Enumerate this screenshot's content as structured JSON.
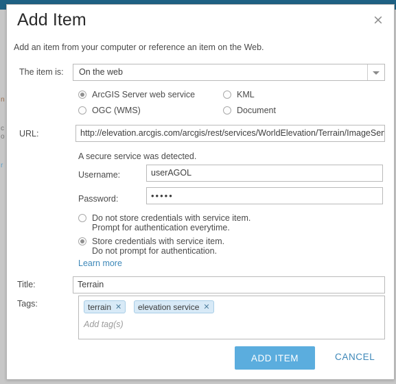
{
  "background": {
    "ghost_lines": [
      "n",
      "c",
      "o",
      "r"
    ]
  },
  "dialog": {
    "title": "Add Item",
    "close_icon": "×",
    "subtitle": "Add an item from your computer or reference an item on the Web.",
    "item_is": {
      "label": "The item is:",
      "selected": "On the web",
      "options": [
        "On the web"
      ]
    },
    "type_radios": [
      {
        "label": "ArcGIS Server web service",
        "checked": true
      },
      {
        "label": "KML",
        "checked": false
      },
      {
        "label": "OGC (WMS)",
        "checked": false
      },
      {
        "label": "Document",
        "checked": false
      }
    ],
    "url": {
      "label": "URL:",
      "value": "http://elevation.arcgis.com/arcgis/rest/services/WorldElevation/Terrain/ImageServer"
    },
    "secure_note": "A secure service was detected.",
    "username": {
      "label": "Username:",
      "value": "userAGOL"
    },
    "password": {
      "label": "Password:",
      "value": "•••••"
    },
    "credential_radios": [
      {
        "line1": "Do not store credentials with service item.",
        "line2": "Prompt for authentication everytime.",
        "checked": false
      },
      {
        "line1": "Store credentials with service item.",
        "line2": "Do not prompt for authentication.",
        "checked": true
      }
    ],
    "learn_more": "Learn more",
    "title_field": {
      "label": "Title:",
      "value": "Terrain"
    },
    "tags_field": {
      "label": "Tags:",
      "tags": [
        "terrain",
        "elevation service"
      ],
      "remove_icon": "✕",
      "placeholder": "Add tag(s)"
    },
    "footer": {
      "primary": "ADD ITEM",
      "cancel": "CANCEL"
    }
  },
  "colors": {
    "accent": "#5badde",
    "link": "#3c87b8",
    "topbar": "#1f6184",
    "tag_bg": "#d8eaf7"
  }
}
